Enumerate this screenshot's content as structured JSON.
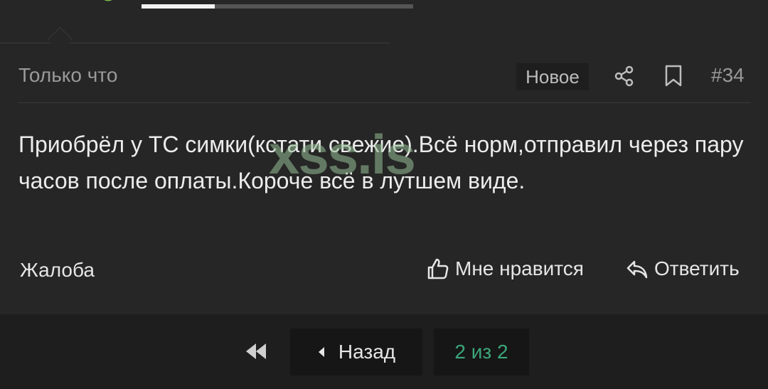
{
  "post": {
    "timestamp": "Только что",
    "badge": "Новое",
    "number": "#34",
    "message": "Приобрёл у ТС симки(кстати свежие).Всё норм,отправил через пару часов после оплаты.Короче всё в лутшем виде.",
    "watermark": "xss.is"
  },
  "actions": {
    "report": "Жалоба",
    "like": "Мне нравится",
    "reply": "Ответить"
  },
  "pagination": {
    "back": "Назад",
    "page": "2 из 2"
  },
  "progress": {
    "fraction": 0.27
  },
  "icons": [
    "share-icon",
    "bookmark-icon",
    "thumbs-up-icon",
    "reply-icon",
    "double-chevron-left-icon",
    "caret-left-icon"
  ],
  "colors": {
    "background": "#262626",
    "accent": "#3ca77a",
    "text": "#e6e6e6",
    "muted": "#9a9a9a"
  }
}
